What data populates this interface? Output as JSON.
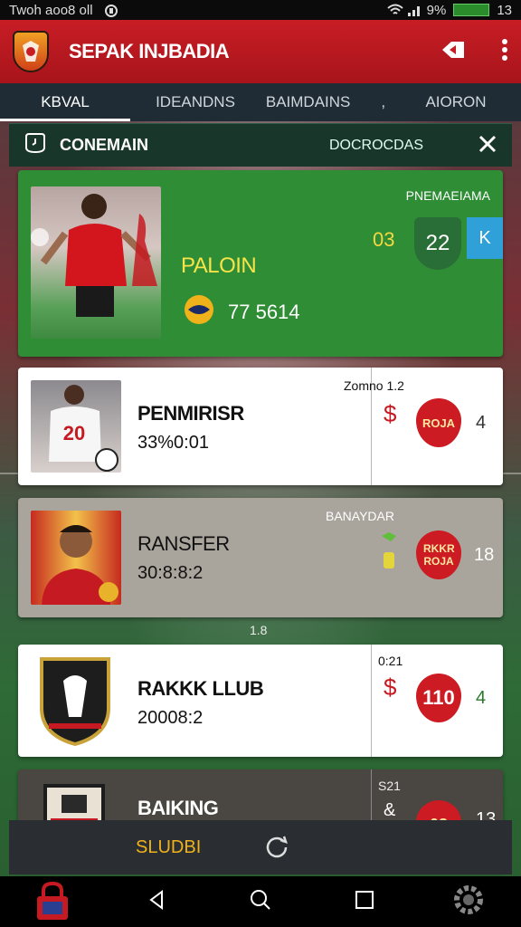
{
  "status_bar": {
    "left_text": "Twoh aoo8 oll",
    "signal_text": "9%",
    "battery_text": "",
    "time_text": "13"
  },
  "app_bar": {
    "title": "SEPAK INJBADIA"
  },
  "tabs": [
    {
      "label": "KBVAL",
      "active": true
    },
    {
      "label": "IDEANDNS",
      "active": false
    },
    {
      "label": "BAIMDAINS",
      "active": false
    },
    {
      "label": "AIORON",
      "active": false
    }
  ],
  "tab_separator": ",",
  "panel_header": {
    "title": "CONEMAIN",
    "subtitle": "DOCROCDAS"
  },
  "featured": {
    "tag": "PNEMAEIAMA",
    "name": "PALOIN",
    "score_a": "03",
    "score_b": "22",
    "corner": "K",
    "rating": "77 5614"
  },
  "rows": [
    {
      "top_label": "Zomno 1.2",
      "name": "PENMIRISR",
      "value": "33%0:01",
      "currency": "$",
      "badge": "ROJA",
      "count": "4"
    },
    {
      "top_label": "BANAYDAR",
      "name": "RANSFER",
      "value": "30:8:8:2",
      "currency": "",
      "badge": "RKKR ROJA",
      "count": "18"
    },
    {
      "top_label": "0:21",
      "name": "RAKKK LLUB",
      "value": "20008:2",
      "currency": "$",
      "badge": "110",
      "count": "4"
    },
    {
      "top_label": "S21",
      "name": "BAIKING",
      "value": "SLUDBI",
      "currency": "&",
      "badge": "08",
      "count": "13"
    }
  ],
  "separator_text": "1.8",
  "colors": {
    "brand_red": "#c81d25",
    "featured_green": "#2e8d35",
    "tab_bg": "#1f2c35"
  }
}
